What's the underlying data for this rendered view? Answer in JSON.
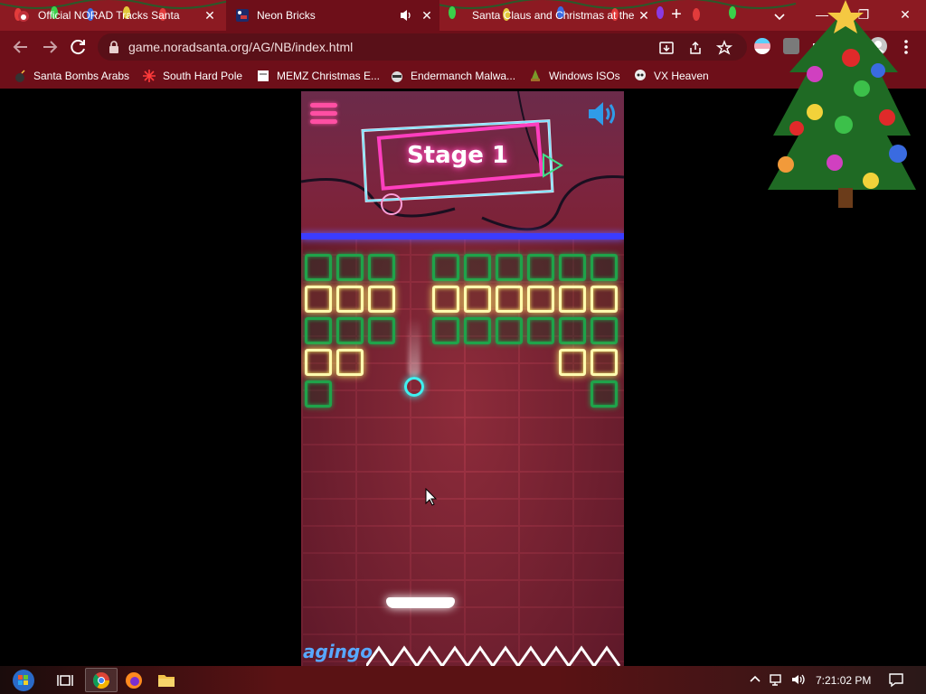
{
  "browser": {
    "tabs": [
      {
        "title": "Official NORAD Tracks Santa",
        "active": false
      },
      {
        "title": "Neon Bricks",
        "active": true
      },
      {
        "title": "Santa Claus and Christmas at the",
        "active": false
      }
    ],
    "url": "game.noradsanta.org/AG/NB/index.html",
    "bookmarks": [
      {
        "label": "Santa Bombs Arabs"
      },
      {
        "label": "South Hard Pole"
      },
      {
        "label": "MEMZ Christmas E..."
      },
      {
        "label": "Endermanch Malwa..."
      },
      {
        "label": "Windows ISOs"
      },
      {
        "label": "VX Heaven"
      }
    ],
    "colors": {
      "tabstrip": "#8c1a22",
      "toolbar": "#6e0f19"
    }
  },
  "game": {
    "stage_label": "Stage 1",
    "brand": "agingo",
    "colors": {
      "green_brick": "#1fa34a",
      "yellow_brick": "#fffbb0",
      "ball": "#3ff0f0",
      "menu": "#ff4fa3",
      "sound": "#2f9be8"
    }
  },
  "taskbar": {
    "clock": "7:21:02 PM"
  }
}
